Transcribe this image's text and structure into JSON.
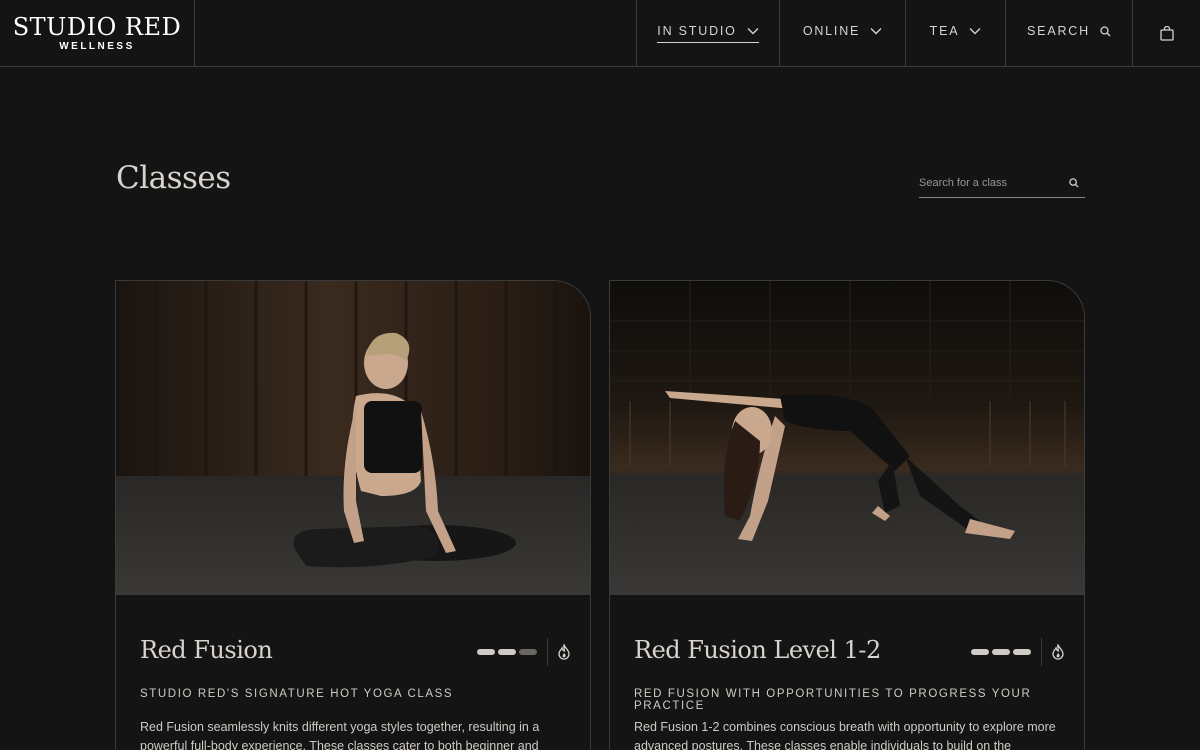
{
  "brand": {
    "name": "STUDIO RED",
    "tagline": "WELLNESS"
  },
  "nav": {
    "in_studio": "IN STUDIO",
    "online": "ONLINE",
    "tea": "TEA",
    "search": "SEARCH"
  },
  "page": {
    "title": "Classes",
    "search_placeholder": "Search for a class"
  },
  "cards": [
    {
      "title": "Red Fusion",
      "subtitle": "STUDIO RED'S SIGNATURE HOT YOGA CLASS",
      "description": "Red Fusion seamlessly knits different yoga styles together, resulting in a powerful full-body experience. These classes cater to both beginner and experienced",
      "level_filled": 2,
      "level_total": 3,
      "heat_icon": "flame-icon"
    },
    {
      "title": "Red Fusion Level 1-2",
      "subtitle": "RED FUSION WITH OPPORTUNITIES TO PROGRESS YOUR PRACTICE",
      "description": "Red Fusion 1-2 combines conscious breath with opportunity to explore more advanced postures. These classes enable individuals to build on the foundation of",
      "level_filled": 3,
      "level_total": 3,
      "heat_icon": "flame-icon"
    }
  ],
  "colors": {
    "background": "#141414",
    "border": "#3a3a3a",
    "text": "#d8d3cc"
  }
}
